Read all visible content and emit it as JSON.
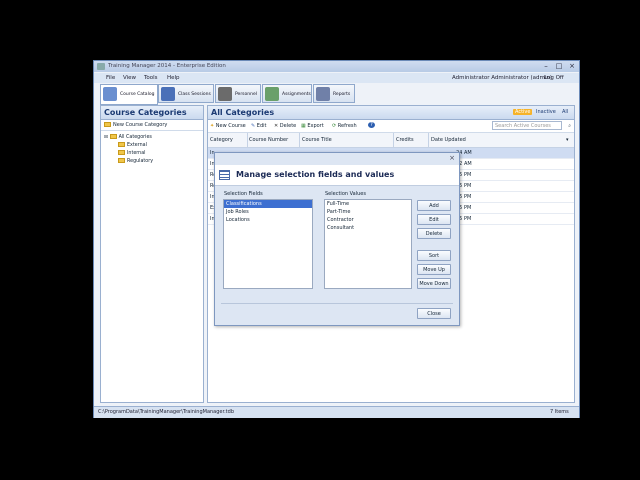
{
  "window": {
    "title": "Training Manager 2014 - Enterprise Edition"
  },
  "menu": [
    "File",
    "View",
    "Tools",
    "Help"
  ],
  "user": {
    "label": "Administrator Administrator (admin)",
    "logoff": "Log Off"
  },
  "tabs": [
    {
      "label": "Course Catalog",
      "color": "#6a8fd0"
    },
    {
      "label": "Class Sessions",
      "color": "#4a70b8"
    },
    {
      "label": "Personnel",
      "color": "#6b6b6b"
    },
    {
      "label": "Assignments",
      "color": "#6aa06a"
    },
    {
      "label": "Reports",
      "color": "#7080a8"
    }
  ],
  "left": {
    "title": "Course Categories",
    "new_label": "New Course Category",
    "tree": [
      "All Categories",
      "External",
      "Internal",
      "Regulatory"
    ]
  },
  "main": {
    "title": "All Categories",
    "filters": [
      "Active",
      "Inactive",
      "All"
    ],
    "toolbar": [
      "New Course",
      "Edit",
      "Delete",
      "Export",
      "Refresh"
    ],
    "search_placeholder": "Search Active Courses",
    "columns": [
      "Category",
      "Course Number",
      "Course Title",
      "Credits",
      "Date Updated"
    ],
    "rows": [
      {
        "c": "In",
        "d": "24 AM"
      },
      {
        "c": "In",
        "d": "22 AM"
      },
      {
        "c": "Re",
        "d": "15 PM"
      },
      {
        "c": "Re",
        "d": "15 PM"
      },
      {
        "c": "In",
        "d": "15 PM"
      },
      {
        "c": "Ex",
        "d": "15 PM"
      },
      {
        "c": "In",
        "d": "15 PM"
      }
    ]
  },
  "dialog": {
    "title": "Manage selection fields and values",
    "fields_label": "Selection Fields",
    "values_label": "Selection Values",
    "fields": [
      "Classifications",
      "Job Roles",
      "Locations"
    ],
    "values": [
      "Full-Time",
      "Part-Time",
      "Contractor",
      "Consultant"
    ],
    "buttons": [
      "Add",
      "Edit",
      "Delete",
      "Sort",
      "Move Up",
      "Move Down"
    ],
    "close": "Close"
  },
  "status": {
    "path": "C:\\ProgramData\\TrainingManager\\TrainingManager.tdb",
    "count": "7 Items"
  }
}
